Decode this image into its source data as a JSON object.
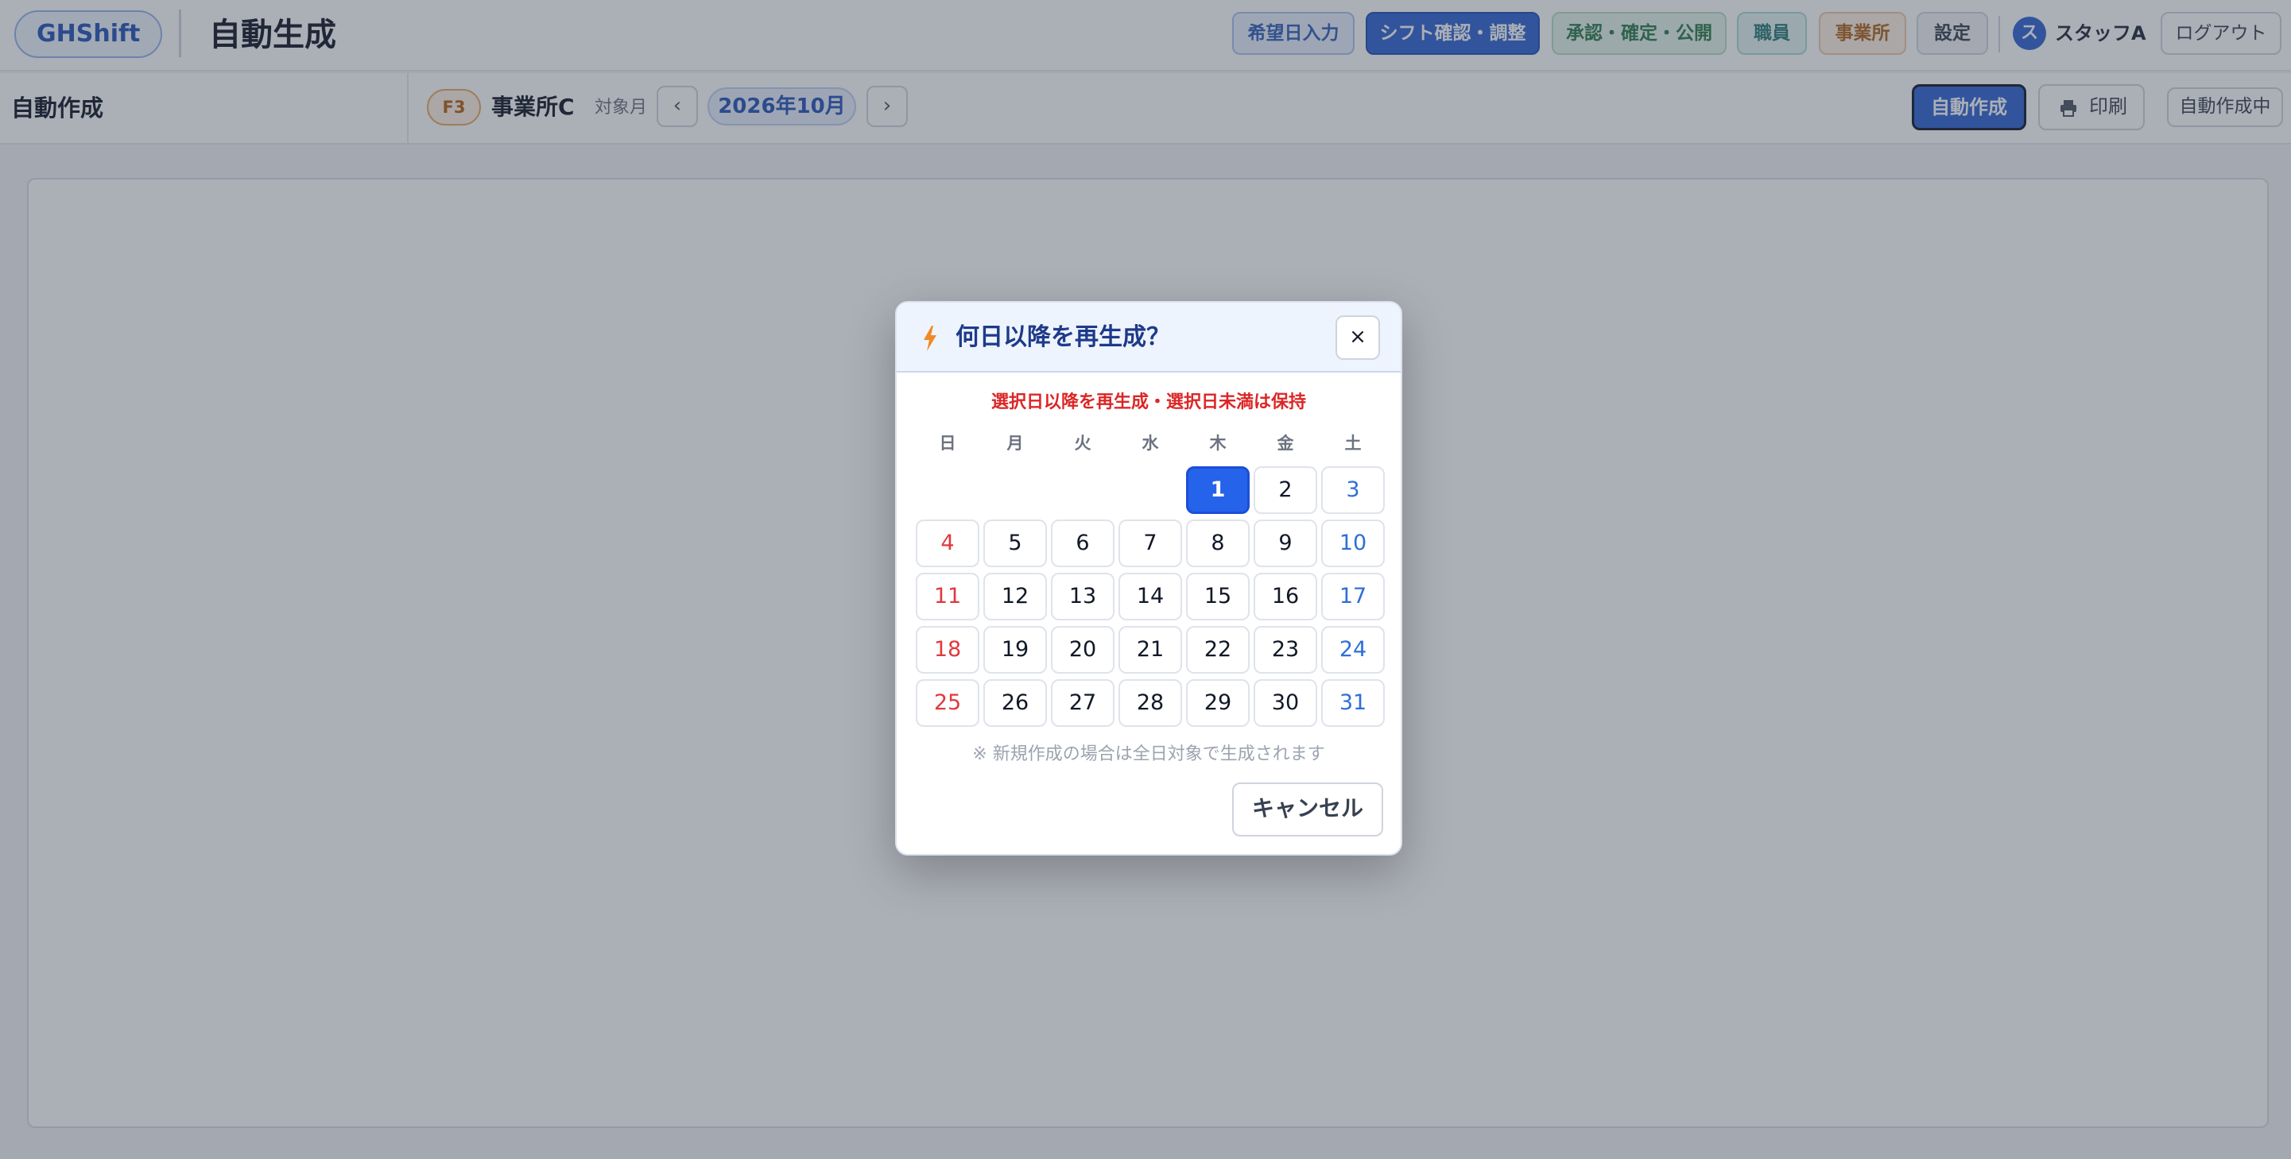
{
  "header": {
    "logo": "GHShift",
    "title": "自動生成",
    "nav": {
      "kibou": "希望日入力",
      "shift": "シフト確認・調整",
      "approve": "承認・確定・公開",
      "staff": "職員",
      "office": "事業所",
      "settings": "設定"
    },
    "user": {
      "avatar": "ス",
      "name": "スタッフA"
    },
    "logout": "ログアウト"
  },
  "subbar": {
    "side_title": "自動作成",
    "office_code": "F3",
    "office_name": "事業所C",
    "month_label": "対象月",
    "prev": "‹",
    "month": "2026年10月",
    "next": "›",
    "auto_button": "自動作成",
    "print_button": "印刷",
    "status_button": "自動作成中"
  },
  "modal": {
    "title": "何日以降を再生成？",
    "close": "×",
    "note": "選択日以降を再生成・選択日未満は保持",
    "weekdays": [
      "日",
      "月",
      "火",
      "水",
      "木",
      "金",
      "土"
    ],
    "days": [
      "1",
      "2",
      "3",
      "4",
      "5",
      "6",
      "7",
      "8",
      "9",
      "10",
      "11",
      "12",
      "13",
      "14",
      "15",
      "16",
      "17",
      "18",
      "19",
      "20",
      "21",
      "22",
      "23",
      "24",
      "25",
      "26",
      "27",
      "28",
      "29",
      "30",
      "31"
    ],
    "first_weekday_index": 4,
    "selected_day": "1",
    "hint": "※ 新規作成の場合は全日対象で生成されます",
    "cancel": "キャンセル"
  },
  "icons": {
    "modal_title": "bolt-icon",
    "print": "printer-icon"
  },
  "colors": {
    "primary": "#2e63d2",
    "selected_day": "#2563eb",
    "sunday": "#e0393e",
    "saturday": "#2e6fd6",
    "warning_text": "#dc2626"
  }
}
